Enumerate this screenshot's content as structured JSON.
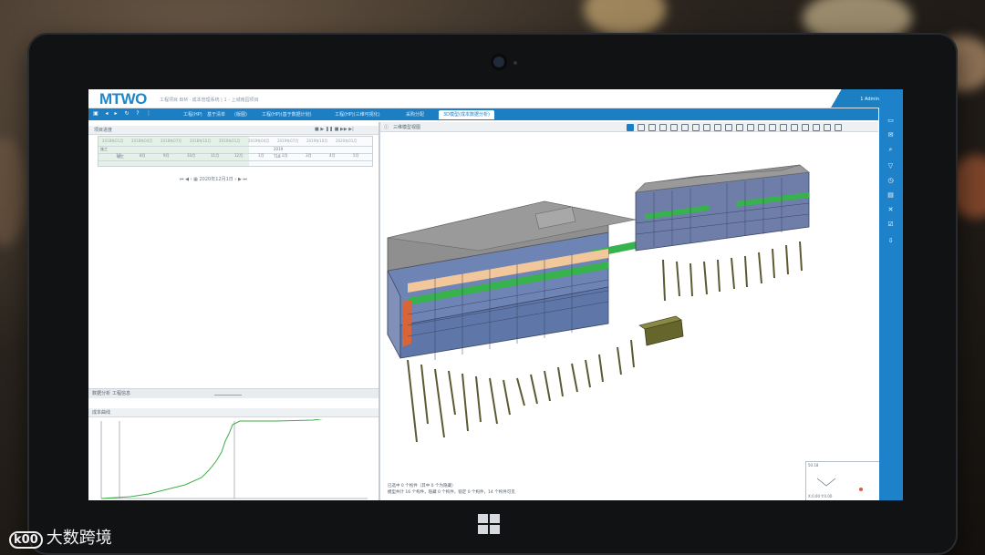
{
  "app": {
    "logo": "MTWO",
    "subtitle": "工程项目 BIM · 成本管理系统 | 1 - 上城南园项目",
    "user": "1 Admin"
  },
  "tabs": [
    {
      "label": "工程(HP)",
      "active": false
    },
    {
      "label": "基于清单",
      "active": false
    },
    {
      "label": "(版图)",
      "active": false
    },
    {
      "label": "工程(HP)(基于数据计划)",
      "active": false
    },
    {
      "label": "工程(HP)(三维可视化)",
      "active": false
    },
    {
      "label": "采购分配",
      "active": false
    },
    {
      "label": "3D模型(成本数据分析)",
      "active": true
    }
  ],
  "left_panel": {
    "title": "项目进度",
    "timeline_ticks": [
      "2018年01月",
      "2018年04月",
      "2018年07月",
      "2018年10月",
      "2019年01月",
      "2019年04月",
      "2019年07月",
      "2019年10月",
      "2020年01月"
    ],
    "row_labels": [
      "施工",
      "竣工"
    ],
    "row_markers": [
      "2019",
      "T18"
    ],
    "months": [
      "7月",
      "8月",
      "9月",
      "10月",
      "11月",
      "12月",
      "1月",
      "2月",
      "3月",
      "4月",
      "5月"
    ],
    "date_label": "2020年12月1日",
    "bottom_tabs": [
      "数据分析",
      "工程信息"
    ],
    "curve_title": "成本曲线"
  },
  "viewport": {
    "title": "三维模型视图",
    "status_lines": [
      "已选中 0 个构件（其中 0 个为隐藏）",
      "模型共计 16 个构件，隐藏 0 个构件，锁定 0 个构件，14 个构件可见"
    ],
    "minimap_label": "50.18",
    "minimap_coord": "X:0.00  Y:0.00"
  },
  "overlay": {
    "watermark": "大数跨境",
    "watermark_mark": "k00"
  },
  "colors": {
    "brand": "#1c7fc4",
    "curve": "#3fae49"
  },
  "icons": {
    "toolbar": [
      "save-icon",
      "back-icon",
      "forward-icon",
      "refresh-icon",
      "help-icon",
      "more-icon"
    ],
    "right_sidebar": [
      "folder-icon",
      "mail-icon",
      "search-icon",
      "filter-icon",
      "clock-icon",
      "document-icon",
      "tools-icon",
      "checklist-icon",
      "download-icon"
    ]
  }
}
